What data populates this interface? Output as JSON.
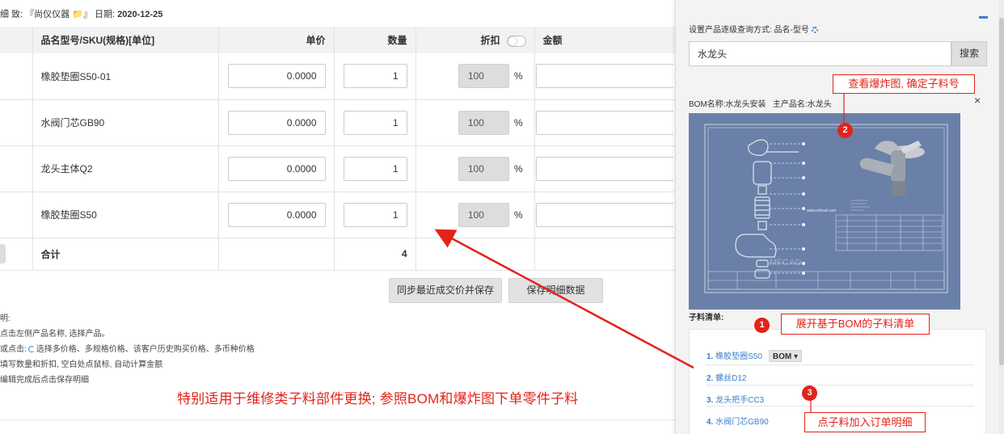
{
  "header": {
    "info_prefix": "细 致: 『尚仪仪器 ",
    "info_suffix": "』 日期: ",
    "date": "2020-12-25"
  },
  "table": {
    "headers": {
      "product": "品名型号/SKU(规格)[单位]",
      "price": "单价",
      "qty": "数量",
      "discount": "折扣",
      "amount": "金额"
    },
    "rows": [
      {
        "name": "橡胶垫圈S50-01",
        "price": "0.0000",
        "qty": "1",
        "discount": "100",
        "pct": "%"
      },
      {
        "name": "水阀门芯GB90",
        "price": "0.0000",
        "qty": "1",
        "discount": "100",
        "pct": "%"
      },
      {
        "name": "龙头主体Q2",
        "price": "0.0000",
        "qty": "1",
        "discount": "100",
        "pct": "%"
      },
      {
        "name": "橡胶垫圈S50",
        "price": "0.0000",
        "qty": "1",
        "discount": "100",
        "pct": "%"
      }
    ],
    "total_label": "合计",
    "total_qty": "4"
  },
  "buttons": {
    "sync": "同步最近成交价并保存",
    "save": "保存明细数据"
  },
  "instructions": {
    "title": "明:",
    "line1": "点击左侧产品名称, 选择产品。",
    "line2_prefix": "或点击:",
    "line2_suffix": "选择多价格、多规格价格、该客户历史购买价格、多币种价格",
    "line3": "填写数量和折扣, 空白处点鼠标, 自动计算金额",
    "line4": "编辑完成后点击保存明细"
  },
  "annotation_main": "特别适用于维修类子料部件更换; 参照BOM和爆炸图下单零件子料",
  "panel": {
    "query_mode": "设置产品逐级查询方式: 品名-型号",
    "search_value": "水龙头",
    "search_button": "搜索",
    "bom_name_label": "BOM名称:水龙头安装",
    "main_product_label": "主产品名:水龙头",
    "close_symbol": "×",
    "drawing_watermark": "www.mfcad.com",
    "drawing_brand": "MFCAD",
    "sub_list_title": "子料清单:",
    "sub_items": [
      {
        "num": "1.",
        "name": "橡胶垫圈S50"
      },
      {
        "num": "2.",
        "name": "螺丝D12"
      },
      {
        "num": "3.",
        "name": "龙头把手CC3"
      },
      {
        "num": "4.",
        "name": "水阀门芯GB90"
      }
    ],
    "bom_tag": "BOM ▾"
  },
  "callouts": {
    "c1": "展开基于BOM的子料清单",
    "c2": "查看爆炸图, 确定子料号",
    "c3": "点子料加入订单明细",
    "b1": "1",
    "b2": "2",
    "b3": "3"
  },
  "colors": {
    "accent": "#3d7fc9",
    "annotation": "#e2231a",
    "drawing_bg": "#6a80a8"
  }
}
